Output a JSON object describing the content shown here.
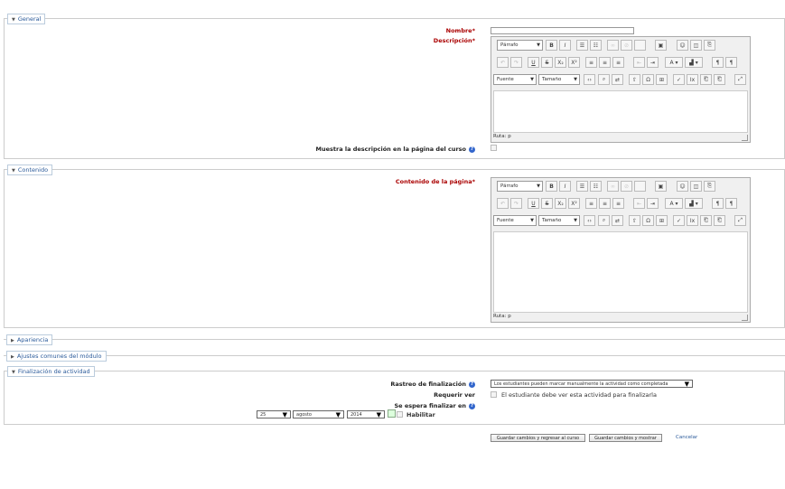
{
  "general": {
    "legend": "General",
    "name_label": "Nombre",
    "desc_label": "Descripción",
    "show_desc_label": "Muestra la descripción en la página del curso",
    "path_label": "Ruta: p"
  },
  "contenido": {
    "legend": "Contenido",
    "page_content_label": "Contenido de la página",
    "path_label": "Ruta: p"
  },
  "toolbar": {
    "paragraph": "Párrafo",
    "font": "Fuente",
    "size": "Tamaño",
    "bold": "B",
    "italic": "I",
    "underline": "U",
    "strike": "S",
    "subscript": "X₂",
    "superscript": "X²"
  },
  "apariencia": {
    "legend": "Apariencia"
  },
  "ajustes": {
    "legend": "Ajustes comunes del módulo"
  },
  "finalizacion": {
    "legend": "Finalización de actividad",
    "tracking_label": "Rastreo de finalización",
    "tracking_value": "Los estudiantes pueden marcar manualmente la actividad como completada",
    "require_view_label": "Requerir ver",
    "require_view_text": "El estudiante debe ver esta actividad para finalizarla",
    "expected_label": "Se espera finalizar en",
    "day": "25",
    "month": "agosto",
    "year": "2014",
    "enable_label": "Habilitar"
  },
  "buttons": {
    "save_return": "Guardar cambios y regresar al curso",
    "save_show": "Guardar cambios y mostrar",
    "cancel": "Cancelar"
  },
  "required_mark": "*"
}
